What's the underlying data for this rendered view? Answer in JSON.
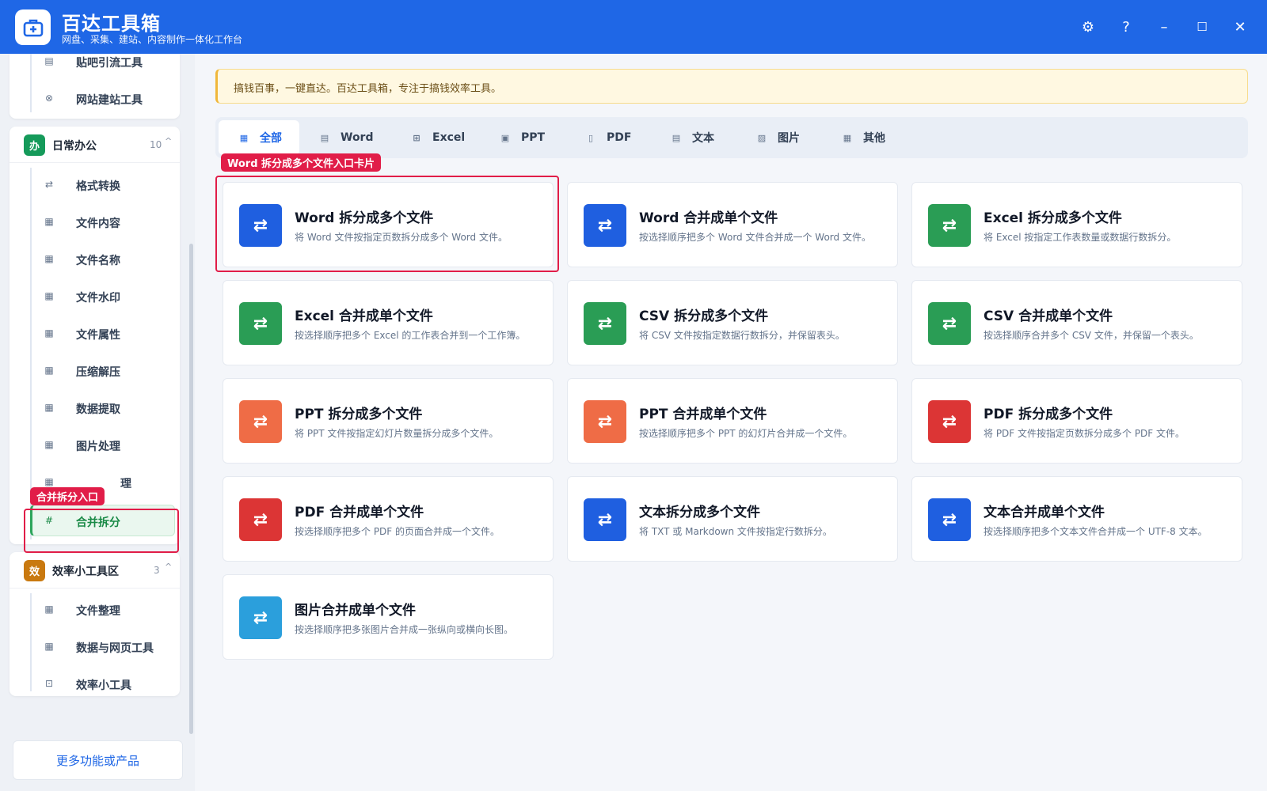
{
  "app": {
    "title": "百达工具箱",
    "subtitle": "网盘、采集、建站、内容制作一体化工作台"
  },
  "window_controls": {
    "settings": "⚙",
    "help": "?",
    "minimize": "–",
    "maximize": "☐",
    "close": "✕"
  },
  "sidebar": {
    "top_items": [
      {
        "label": "贴吧引流工具",
        "icon": "list-icon"
      },
      {
        "label": "网站建站工具",
        "icon": "globe-icon"
      }
    ],
    "group_office": {
      "badge": "办",
      "label": "日常办公",
      "count": "10",
      "chevron": "^",
      "items": [
        {
          "label": "格式转换",
          "icon": "swap-icon"
        },
        {
          "label": "文件内容",
          "icon": "grid-icon"
        },
        {
          "label": "文件名称",
          "icon": "grid-icon"
        },
        {
          "label": "文件水印",
          "icon": "grid-icon"
        },
        {
          "label": "文件属性",
          "icon": "grid-icon"
        },
        {
          "label": "压缩解压",
          "icon": "grid-icon"
        },
        {
          "label": "数据提取",
          "icon": "grid-icon"
        },
        {
          "label": "图片处理",
          "icon": "grid-icon"
        },
        {
          "label": "理",
          "icon": "grid-icon"
        },
        {
          "label": "合并拆分",
          "icon": "hash-icon",
          "active": true
        }
      ]
    },
    "group_efficiency": {
      "badge": "效",
      "label": "效率小工具区",
      "count": "3",
      "chevron": "^",
      "items": [
        {
          "label": "文件整理",
          "icon": "grid-icon"
        },
        {
          "label": "数据与网页工具",
          "icon": "grid-icon"
        },
        {
          "label": "效率小工具",
          "icon": "toolbox-icon"
        }
      ]
    },
    "more_button": "更多功能或产品"
  },
  "annotations": {
    "card_tag": "Word 拆分成多个文件入口卡片",
    "sidebar_tag": "合并拆分入口"
  },
  "notice": "搞钱百事，一键直达。百达工具箱，专注于搞钱效率工具。",
  "tabs": [
    {
      "label": "全部",
      "icon": "grid-icon",
      "active": true
    },
    {
      "label": "Word",
      "icon": "doc-icon"
    },
    {
      "label": "Excel",
      "icon": "table-icon"
    },
    {
      "label": "PPT",
      "icon": "slide-icon"
    },
    {
      "label": "PDF",
      "icon": "pdf-icon"
    },
    {
      "label": "文本",
      "icon": "text-icon"
    },
    {
      "label": "图片",
      "icon": "image-icon"
    },
    {
      "label": "其他",
      "icon": "grid-icon"
    }
  ],
  "cards": [
    {
      "title": "Word 拆分成多个文件",
      "desc": "将 Word 文件按指定页数拆分成多个 Word 文件。",
      "color": "#1f5fe0"
    },
    {
      "title": "Word 合并成单个文件",
      "desc": "按选择顺序把多个 Word 文件合并成一个 Word 文件。",
      "color": "#1f5fe0"
    },
    {
      "title": "Excel 拆分成多个文件",
      "desc": "将 Excel 按指定工作表数量或数据行数拆分。",
      "color": "#2a9d55"
    },
    {
      "title": "Excel 合并成单个文件",
      "desc": "按选择顺序把多个 Excel 的工作表合并到一个工作簿。",
      "color": "#2a9d55"
    },
    {
      "title": "CSV 拆分成多个文件",
      "desc": "将 CSV 文件按指定数据行数拆分，并保留表头。",
      "color": "#2a9d55"
    },
    {
      "title": "CSV 合并成单个文件",
      "desc": "按选择顺序合并多个 CSV 文件，并保留一个表头。",
      "color": "#2a9d55"
    },
    {
      "title": "PPT 拆分成多个文件",
      "desc": "将 PPT 文件按指定幻灯片数量拆分成多个文件。",
      "color": "#ef6c46"
    },
    {
      "title": "PPT 合并成单个文件",
      "desc": "按选择顺序把多个 PPT 的幻灯片合并成一个文件。",
      "color": "#ef6c46"
    },
    {
      "title": "PDF 拆分成多个文件",
      "desc": "将 PDF 文件按指定页数拆分成多个 PDF 文件。",
      "color": "#dc3535"
    },
    {
      "title": "PDF 合并成单个文件",
      "desc": "按选择顺序把多个 PDF 的页面合并成一个文件。",
      "color": "#dc3535"
    },
    {
      "title": "文本拆分成多个文件",
      "desc": "将 TXT 或 Markdown 文件按指定行数拆分。",
      "color": "#1f5fe0"
    },
    {
      "title": "文本合并成单个文件",
      "desc": "按选择顺序把多个文本文件合并成一个 UTF-8 文本。",
      "color": "#1f5fe0"
    },
    {
      "title": "图片合并成单个文件",
      "desc": "按选择顺序把多张图片合并成一张纵向或横向长图。",
      "color": "#2b9fdc"
    }
  ]
}
